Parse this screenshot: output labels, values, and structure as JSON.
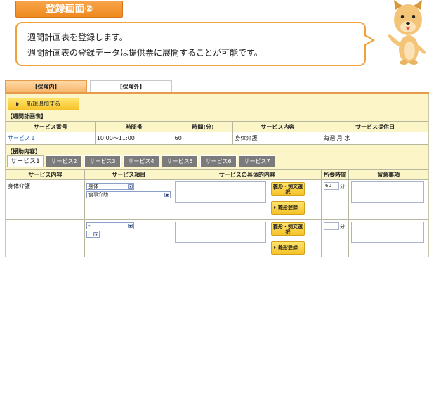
{
  "header": {
    "label": "登録画面②",
    "line1": "週間計画表を登録します。",
    "line2": "週間計画表の登録データは提供票に展開することが可能です。"
  },
  "tabs_top": [
    "【保険内】",
    "【保険外】"
  ],
  "add_button": "新規追加する",
  "schedule": {
    "section": "【週間計画表】",
    "headers": [
      "サービス番号",
      "時間帯",
      "時間(分)",
      "サービス内容",
      "サービス提供日"
    ],
    "row": {
      "number": "サービス１",
      "time": "10:00〜11:00",
      "minutes": "60",
      "content": "身体介護",
      "days": "毎週 月 水"
    }
  },
  "assist": {
    "section": "【援助内容】",
    "tabs": [
      "サービス1",
      "サービス2",
      "サービス3",
      "サービス4",
      "サービス5",
      "サービス6",
      "サービス7"
    ],
    "headers": [
      "サービス内容",
      "サービス項目",
      "サービスの具体的内容",
      "所要時間",
      "留意事項"
    ],
    "rows": [
      {
        "content": "身体介護",
        "item1": "身体",
        "item2": "食事介助",
        "btn1": "雛形・例文選択",
        "btn2": "雛形登録",
        "minutes": "60",
        "unit": "分"
      },
      {
        "content": "",
        "item1": "-",
        "item2": "-",
        "btn1": "雛形・例文選択",
        "btn2": "雛形登録",
        "minutes": "",
        "unit": "分"
      }
    ]
  }
}
